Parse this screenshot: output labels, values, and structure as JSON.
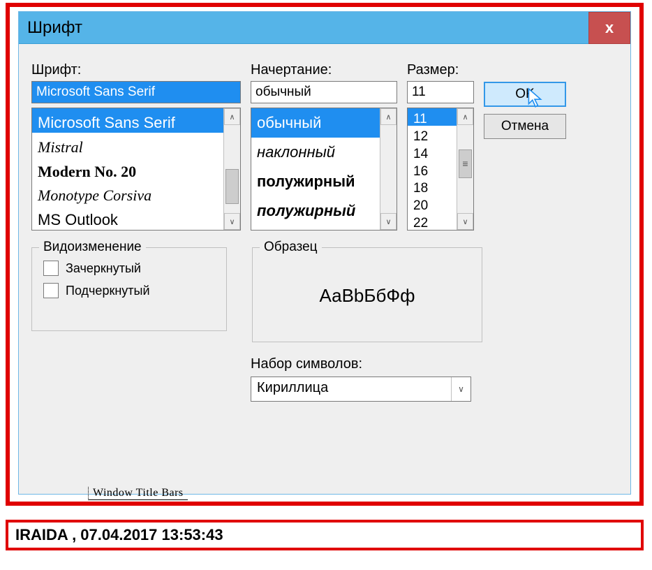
{
  "dialog": {
    "title": "Шрифт",
    "close": "x"
  },
  "font": {
    "label": "Шрифт:",
    "value": "Microsoft Sans Serif",
    "items": [
      "Microsoft Sans Serif",
      "Mistral",
      "Modern No. 20",
      "Monotype Corsiva",
      "MS Outlook"
    ]
  },
  "style": {
    "label": "Начертание:",
    "value": "обычный",
    "items": [
      "обычный",
      "наклонный",
      "полужирный",
      "полужирный"
    ]
  },
  "size": {
    "label": "Размер:",
    "value": "11",
    "items": [
      "11",
      "12",
      "14",
      "16",
      "18",
      "20",
      "22"
    ]
  },
  "buttons": {
    "ok": "OK",
    "cancel": "Отмена"
  },
  "effects": {
    "legend": "Видоизменение",
    "strike": "Зачеркнутый",
    "underline": "Подчеркнутый"
  },
  "sample": {
    "legend": "Образец",
    "text": "АаBbБбФф"
  },
  "script": {
    "label": "Набор символов:",
    "value": "Кириллица"
  },
  "fragment": "Window Title Bars",
  "footer": "IRAIDA  ,  07.04.2017 13:53:43"
}
